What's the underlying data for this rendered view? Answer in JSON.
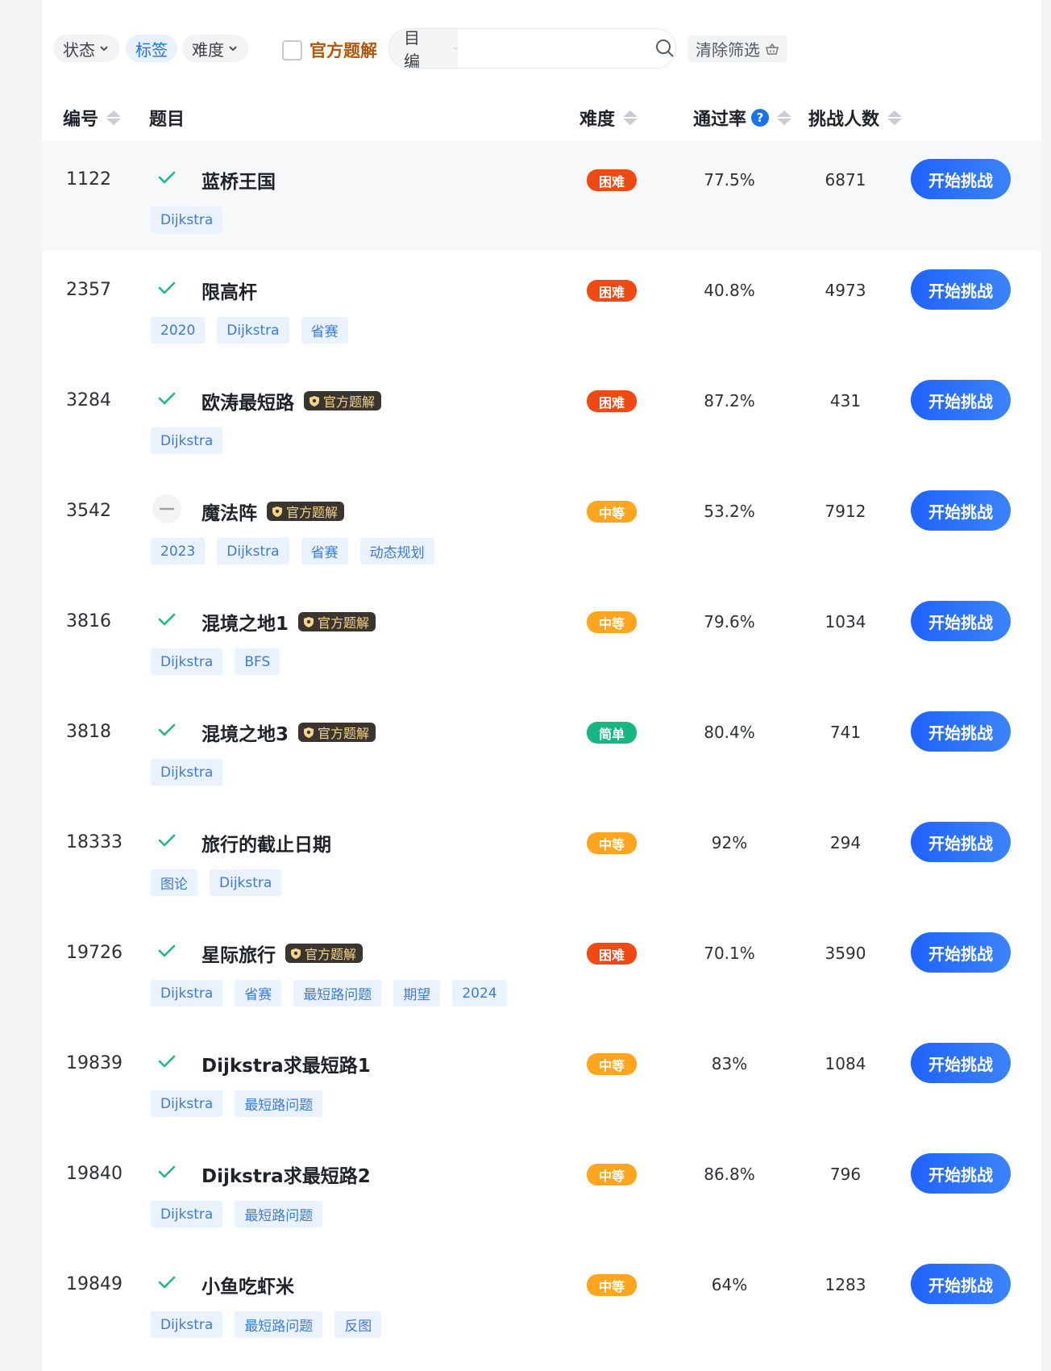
{
  "filters": {
    "status_label": "状态",
    "tags_label": "标签",
    "difficulty_label": "难度",
    "official_label": "官方题解",
    "search_select": "题目编号",
    "search_value": "",
    "clear_label": "清除筛选"
  },
  "table_header": {
    "id": "编号",
    "title": "题目",
    "difficulty": "难度",
    "pass_rate": "通过率",
    "help_glyph": "?",
    "challengers": "挑战人数"
  },
  "colors": {
    "hard": "#f04a14",
    "medium": "#ffa51f",
    "easy": "#17b783",
    "accent": "#1a73e8",
    "check": "#20b783"
  },
  "official_badge_text": "官方题解",
  "button_label": "开始挑战",
  "problems": [
    {
      "id": "1122",
      "status": "done",
      "title": "蓝桥王国",
      "official": false,
      "tags": [
        "Dijkstra"
      ],
      "difficulty": "困难",
      "level": "hard",
      "rate": "77.5%",
      "count": "6871"
    },
    {
      "id": "2357",
      "status": "done",
      "title": "限高杆",
      "official": false,
      "tags": [
        "2020",
        "Dijkstra",
        "省赛"
      ],
      "difficulty": "困难",
      "level": "hard",
      "rate": "40.8%",
      "count": "4973"
    },
    {
      "id": "3284",
      "status": "done",
      "title": "欧涛最短路",
      "official": true,
      "tags": [
        "Dijkstra"
      ],
      "difficulty": "困难",
      "level": "hard",
      "rate": "87.2%",
      "count": "431"
    },
    {
      "id": "3542",
      "status": "attempted",
      "title": "魔法阵",
      "official": true,
      "tags": [
        "2023",
        "Dijkstra",
        "省赛",
        "动态规划"
      ],
      "difficulty": "中等",
      "level": "medium",
      "rate": "53.2%",
      "count": "7912"
    },
    {
      "id": "3816",
      "status": "done",
      "title": "混境之地1",
      "official": true,
      "tags": [
        "Dijkstra",
        "BFS"
      ],
      "difficulty": "中等",
      "level": "medium",
      "rate": "79.6%",
      "count": "1034"
    },
    {
      "id": "3818",
      "status": "done",
      "title": "混境之地3",
      "official": true,
      "tags": [
        "Dijkstra"
      ],
      "difficulty": "简单",
      "level": "easy",
      "rate": "80.4%",
      "count": "741"
    },
    {
      "id": "18333",
      "status": "done",
      "title": "旅行的截止日期",
      "official": false,
      "tags": [
        "图论",
        "Dijkstra"
      ],
      "difficulty": "中等",
      "level": "medium",
      "rate": "92%",
      "count": "294"
    },
    {
      "id": "19726",
      "status": "done",
      "title": "星际旅行",
      "official": true,
      "tags": [
        "Dijkstra",
        "省赛",
        "最短路问题",
        "期望",
        "2024"
      ],
      "difficulty": "困难",
      "level": "hard",
      "rate": "70.1%",
      "count": "3590"
    },
    {
      "id": "19839",
      "status": "done",
      "title": "Dijkstra求最短路1",
      "official": false,
      "tags": [
        "Dijkstra",
        "最短路问题"
      ],
      "difficulty": "中等",
      "level": "medium",
      "rate": "83%",
      "count": "1084"
    },
    {
      "id": "19840",
      "status": "done",
      "title": "Dijkstra求最短路2",
      "official": false,
      "tags": [
        "Dijkstra",
        "最短路问题"
      ],
      "difficulty": "中等",
      "level": "medium",
      "rate": "86.8%",
      "count": "796"
    },
    {
      "id": "19849",
      "status": "done",
      "title": "小鱼吃虾米",
      "official": false,
      "tags": [
        "Dijkstra",
        "最短路问题",
        "反图"
      ],
      "difficulty": "中等",
      "level": "medium",
      "rate": "64%",
      "count": "1283"
    }
  ]
}
